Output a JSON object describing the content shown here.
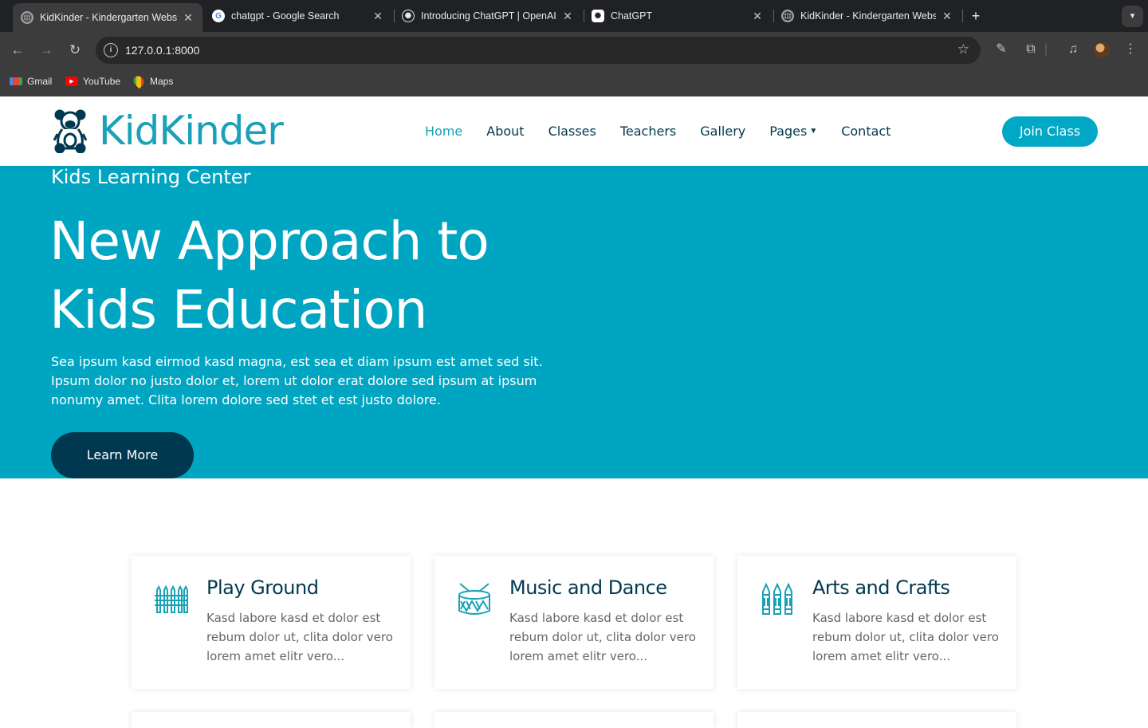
{
  "browser": {
    "tabs": [
      {
        "title": "KidKinder - Kindergarten Website",
        "favicon": "globe-icon",
        "active": true
      },
      {
        "title": "chatgpt - Google Search",
        "favicon": "google-icon",
        "active": false
      },
      {
        "title": "Introducing ChatGPT | OpenAI",
        "favicon": "openai-icon",
        "active": false
      },
      {
        "title": "ChatGPT",
        "favicon": "openai-icon",
        "active": false
      },
      {
        "title": "KidKinder - Kindergarten Website",
        "favicon": "globe-icon",
        "active": false
      }
    ],
    "url": "127.0.0.1:8000",
    "bookmarks": [
      {
        "label": "Gmail",
        "icon": "gmail-icon"
      },
      {
        "label": "YouTube",
        "icon": "youtube-icon"
      },
      {
        "label": "Maps",
        "icon": "maps-icon"
      }
    ]
  },
  "site": {
    "brand": "KidKinder",
    "nav": [
      "Home",
      "About",
      "Classes",
      "Teachers",
      "Gallery",
      "Pages",
      "Contact"
    ],
    "active_nav": "Home",
    "join_label": "Join Class",
    "accent": "#17a2b8",
    "dark": "#00394f"
  },
  "hero": {
    "subtitle": "Kids Learning Center",
    "title_line1": "New Approach to",
    "title_line2": "Kids Education",
    "text": "Sea ipsum kasd eirmod kasd magna, est sea et diam ipsum est amet sed sit. Ipsum dolor no justo dolor et, lorem ut dolor erat dolore sed ipsum at ipsum nonumy amet. Clita lorem dolore sed stet et est justo dolore.",
    "button": "Learn More",
    "background": "#00a5c2"
  },
  "features": [
    {
      "title": "Play Ground",
      "icon": "fence-icon",
      "text": "Kasd labore kasd et dolor est rebum dolor ut, clita dolor vero lorem amet elitr vero..."
    },
    {
      "title": "Music and Dance",
      "icon": "drum-icon",
      "text": "Kasd labore kasd et dolor est rebum dolor ut, clita dolor vero lorem amet elitr vero..."
    },
    {
      "title": "Arts and Crafts",
      "icon": "crayons-icon",
      "text": "Kasd labore kasd et dolor est rebum dolor ut, clita dolor vero lorem amet elitr vero..."
    }
  ]
}
